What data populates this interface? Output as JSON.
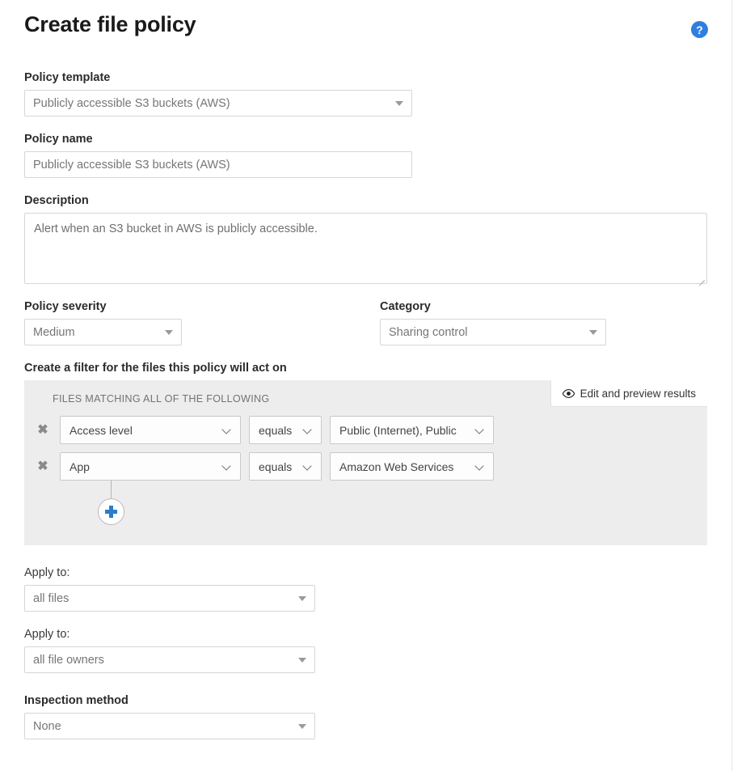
{
  "header": {
    "title": "Create file policy",
    "help_icon": "question-mark-circle-icon",
    "help_label": "?"
  },
  "fields": {
    "policy_template": {
      "label": "Policy template",
      "value": "Publicly accessible S3 buckets (AWS)",
      "type": "select"
    },
    "policy_name": {
      "label": "Policy name",
      "value": "Publicly accessible S3 buckets (AWS)",
      "type": "text"
    },
    "description": {
      "label": "Description",
      "value": "Alert when an S3 bucket in AWS is publicly accessible.",
      "type": "textarea"
    },
    "policy_severity": {
      "label": "Policy severity",
      "value": "Medium",
      "type": "select"
    },
    "category": {
      "label": "Category",
      "value": "Sharing control",
      "type": "select"
    },
    "apply_to_files": {
      "label": "Apply to:",
      "value": "all files",
      "type": "select"
    },
    "apply_to_owners": {
      "label": "Apply to:",
      "value": "all file owners",
      "type": "select"
    },
    "inspection_method": {
      "label": "Inspection method",
      "value": "None",
      "type": "select"
    }
  },
  "filter": {
    "section_label": "Create a filter for the files this policy will act on",
    "match_header": "FILES MATCHING ALL OF THE FOLLOWING",
    "preview_button": {
      "label": "Edit and preview results",
      "icon": "eye-icon"
    },
    "add_button_icon": "plus-icon",
    "remove_icon": "close-x-icon",
    "remove_glyph": "✖",
    "rows": [
      {
        "field": "Access level",
        "operator": "equals",
        "value": "Public (Internet), Public"
      },
      {
        "field": "App",
        "operator": "equals",
        "value": "Amazon Web Services"
      }
    ]
  },
  "colors": {
    "accent_blue": "#2f7fe0",
    "plus_blue": "#2b7cc9",
    "panel_gray": "#ededed",
    "text_dark": "#333333",
    "placeholder_gray": "#767676"
  }
}
